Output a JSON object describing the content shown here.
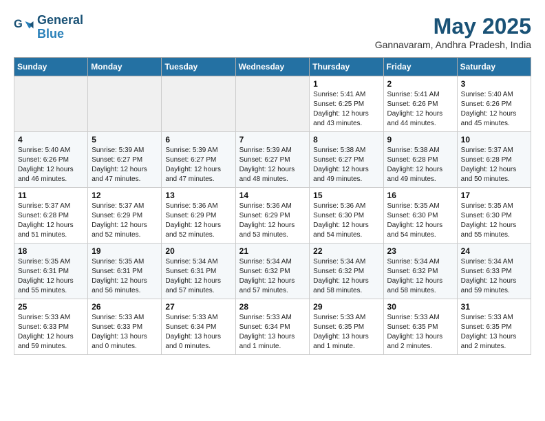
{
  "logo": {
    "line1": "General",
    "line2": "Blue"
  },
  "title": {
    "month_year": "May 2025",
    "location": "Gannavaram, Andhra Pradesh, India"
  },
  "days_of_week": [
    "Sunday",
    "Monday",
    "Tuesday",
    "Wednesday",
    "Thursday",
    "Friday",
    "Saturday"
  ],
  "weeks": [
    [
      {
        "day": "",
        "info": ""
      },
      {
        "day": "",
        "info": ""
      },
      {
        "day": "",
        "info": ""
      },
      {
        "day": "",
        "info": ""
      },
      {
        "day": "1",
        "info": "Sunrise: 5:41 AM\nSunset: 6:25 PM\nDaylight: 12 hours\nand 43 minutes."
      },
      {
        "day": "2",
        "info": "Sunrise: 5:41 AM\nSunset: 6:26 PM\nDaylight: 12 hours\nand 44 minutes."
      },
      {
        "day": "3",
        "info": "Sunrise: 5:40 AM\nSunset: 6:26 PM\nDaylight: 12 hours\nand 45 minutes."
      }
    ],
    [
      {
        "day": "4",
        "info": "Sunrise: 5:40 AM\nSunset: 6:26 PM\nDaylight: 12 hours\nand 46 minutes."
      },
      {
        "day": "5",
        "info": "Sunrise: 5:39 AM\nSunset: 6:27 PM\nDaylight: 12 hours\nand 47 minutes."
      },
      {
        "day": "6",
        "info": "Sunrise: 5:39 AM\nSunset: 6:27 PM\nDaylight: 12 hours\nand 47 minutes."
      },
      {
        "day": "7",
        "info": "Sunrise: 5:39 AM\nSunset: 6:27 PM\nDaylight: 12 hours\nand 48 minutes."
      },
      {
        "day": "8",
        "info": "Sunrise: 5:38 AM\nSunset: 6:27 PM\nDaylight: 12 hours\nand 49 minutes."
      },
      {
        "day": "9",
        "info": "Sunrise: 5:38 AM\nSunset: 6:28 PM\nDaylight: 12 hours\nand 49 minutes."
      },
      {
        "day": "10",
        "info": "Sunrise: 5:37 AM\nSunset: 6:28 PM\nDaylight: 12 hours\nand 50 minutes."
      }
    ],
    [
      {
        "day": "11",
        "info": "Sunrise: 5:37 AM\nSunset: 6:28 PM\nDaylight: 12 hours\nand 51 minutes."
      },
      {
        "day": "12",
        "info": "Sunrise: 5:37 AM\nSunset: 6:29 PM\nDaylight: 12 hours\nand 52 minutes."
      },
      {
        "day": "13",
        "info": "Sunrise: 5:36 AM\nSunset: 6:29 PM\nDaylight: 12 hours\nand 52 minutes."
      },
      {
        "day": "14",
        "info": "Sunrise: 5:36 AM\nSunset: 6:29 PM\nDaylight: 12 hours\nand 53 minutes."
      },
      {
        "day": "15",
        "info": "Sunrise: 5:36 AM\nSunset: 6:30 PM\nDaylight: 12 hours\nand 54 minutes."
      },
      {
        "day": "16",
        "info": "Sunrise: 5:35 AM\nSunset: 6:30 PM\nDaylight: 12 hours\nand 54 minutes."
      },
      {
        "day": "17",
        "info": "Sunrise: 5:35 AM\nSunset: 6:30 PM\nDaylight: 12 hours\nand 55 minutes."
      }
    ],
    [
      {
        "day": "18",
        "info": "Sunrise: 5:35 AM\nSunset: 6:31 PM\nDaylight: 12 hours\nand 55 minutes."
      },
      {
        "day": "19",
        "info": "Sunrise: 5:35 AM\nSunset: 6:31 PM\nDaylight: 12 hours\nand 56 minutes."
      },
      {
        "day": "20",
        "info": "Sunrise: 5:34 AM\nSunset: 6:31 PM\nDaylight: 12 hours\nand 57 minutes."
      },
      {
        "day": "21",
        "info": "Sunrise: 5:34 AM\nSunset: 6:32 PM\nDaylight: 12 hours\nand 57 minutes."
      },
      {
        "day": "22",
        "info": "Sunrise: 5:34 AM\nSunset: 6:32 PM\nDaylight: 12 hours\nand 58 minutes."
      },
      {
        "day": "23",
        "info": "Sunrise: 5:34 AM\nSunset: 6:32 PM\nDaylight: 12 hours\nand 58 minutes."
      },
      {
        "day": "24",
        "info": "Sunrise: 5:34 AM\nSunset: 6:33 PM\nDaylight: 12 hours\nand 59 minutes."
      }
    ],
    [
      {
        "day": "25",
        "info": "Sunrise: 5:33 AM\nSunset: 6:33 PM\nDaylight: 12 hours\nand 59 minutes."
      },
      {
        "day": "26",
        "info": "Sunrise: 5:33 AM\nSunset: 6:33 PM\nDaylight: 13 hours\nand 0 minutes."
      },
      {
        "day": "27",
        "info": "Sunrise: 5:33 AM\nSunset: 6:34 PM\nDaylight: 13 hours\nand 0 minutes."
      },
      {
        "day": "28",
        "info": "Sunrise: 5:33 AM\nSunset: 6:34 PM\nDaylight: 13 hours\nand 1 minute."
      },
      {
        "day": "29",
        "info": "Sunrise: 5:33 AM\nSunset: 6:35 PM\nDaylight: 13 hours\nand 1 minute."
      },
      {
        "day": "30",
        "info": "Sunrise: 5:33 AM\nSunset: 6:35 PM\nDaylight: 13 hours\nand 2 minutes."
      },
      {
        "day": "31",
        "info": "Sunrise: 5:33 AM\nSunset: 6:35 PM\nDaylight: 13 hours\nand 2 minutes."
      }
    ]
  ]
}
